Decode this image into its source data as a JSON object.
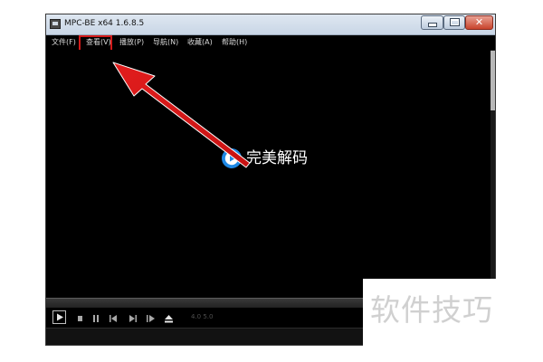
{
  "window": {
    "title": "MPC-BE x64 1.6.8.5",
    "controls": {
      "minimize_icon": "minimize-icon",
      "maximize_icon": "maximize-icon",
      "close_icon": "close-icon",
      "close_label": "✕"
    }
  },
  "menu": {
    "items": [
      {
        "label": "文件(F)",
        "id": "file"
      },
      {
        "label": "查看(V)",
        "id": "view",
        "highlighted": true
      },
      {
        "label": "播放(P)",
        "id": "play"
      },
      {
        "label": "导航(N)",
        "id": "navigate"
      },
      {
        "label": "收藏(A)",
        "id": "favorites"
      },
      {
        "label": "帮助(H)",
        "id": "help"
      }
    ]
  },
  "video": {
    "logo_text": "完美解码",
    "logo_icon": "perfect-decoder-logo-icon"
  },
  "controls": {
    "buttons": [
      {
        "name": "play-button",
        "icon": "play-icon"
      },
      {
        "name": "pause-button",
        "icon": "pause-icon"
      },
      {
        "name": "stop-button",
        "icon": "stop-icon"
      },
      {
        "name": "prev-button",
        "icon": "skip-back-icon"
      },
      {
        "name": "next-button",
        "icon": "skip-forward-icon"
      },
      {
        "name": "frame-step-button",
        "icon": "frame-step-icon"
      },
      {
        "name": "eject-button",
        "icon": "eject-icon"
      }
    ],
    "volume_readout": "4.0  5.0"
  },
  "annotation": {
    "arrow_color": "#e11d1d",
    "highlight_color": "#d21919",
    "target": "menu-view"
  },
  "watermark": {
    "text": "软件技巧"
  },
  "colors": {
    "titlebar_top": "#dfe7f1",
    "titlebar_bottom": "#c9d6e6",
    "video_background": "#000000",
    "menu_text": "#d8d8d8",
    "logo_blue": "#1e88e5"
  }
}
